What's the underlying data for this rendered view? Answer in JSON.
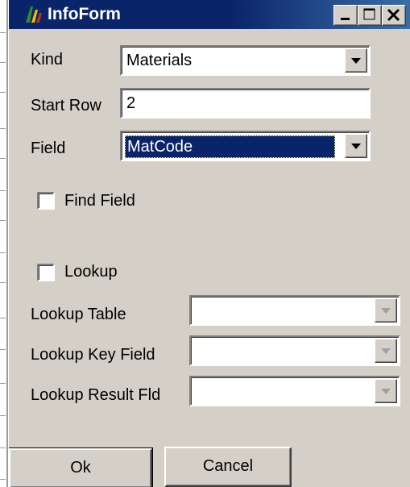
{
  "window": {
    "title": "InfoForm",
    "icon": "app-icon",
    "controls": [
      "minimize",
      "maximize",
      "close"
    ]
  },
  "form": {
    "kind": {
      "label": "Kind",
      "value": "Materials"
    },
    "start_row": {
      "label": "Start Row",
      "value": "2"
    },
    "field": {
      "label": "Field",
      "value": "MatCode"
    },
    "find_field": {
      "label": "Find Field",
      "checked": false
    },
    "lookup": {
      "label": "Lookup",
      "checked": false
    },
    "lookup_table": {
      "label": "Lookup Table",
      "value": ""
    },
    "lookup_key_field": {
      "label": "Lookup Key Field",
      "value": ""
    },
    "lookup_result_fld": {
      "label": "Lookup Result Fld",
      "value": ""
    }
  },
  "buttons": {
    "ok": "Ok",
    "cancel": "Cancel"
  },
  "colors": {
    "titlebar": "#0a246a",
    "face": "#d4d0c8",
    "selection": "#0a246a",
    "disabled_arrow": "#a0a0a0"
  }
}
